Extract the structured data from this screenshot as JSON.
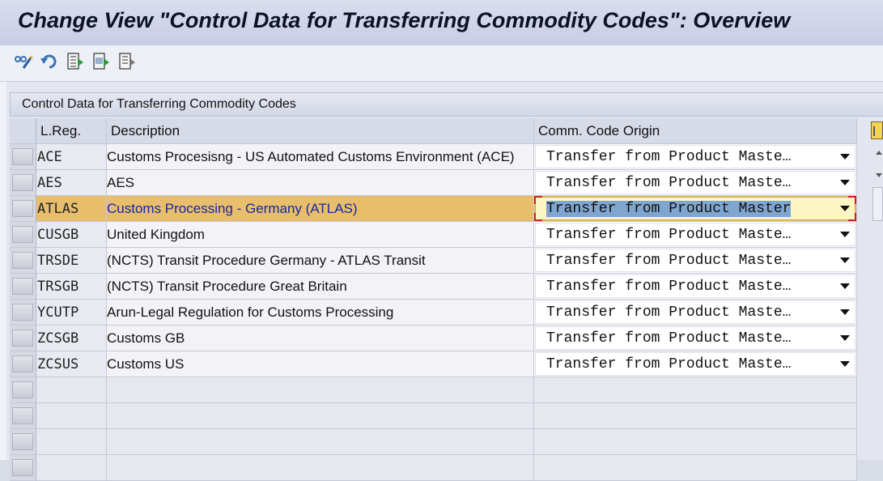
{
  "window": {
    "title": "Change View \"Control Data for Transferring Commodity Codes\": Overview"
  },
  "toolbar": {
    "items": [
      {
        "name": "display-change-icon"
      },
      {
        "name": "undo-icon"
      },
      {
        "name": "select-all-icon"
      },
      {
        "name": "select-block-icon"
      },
      {
        "name": "deselect-all-icon"
      }
    ]
  },
  "table": {
    "title": "Control Data for Transferring Commodity Codes",
    "columns": {
      "lreg": "L.Reg.",
      "description": "Description",
      "origin": "Comm. Code Origin"
    },
    "rows": [
      {
        "lreg": "ACE",
        "description": "Customs Procesisng - US Automated Customs Environment (ACE)",
        "origin": "Transfer from Product Maste…"
      },
      {
        "lreg": "AES",
        "description": "AES",
        "origin": "Transfer from Product Maste…"
      },
      {
        "lreg": "ATLAS",
        "description": "Customs Processing - Germany (ATLAS)",
        "origin": "Transfer from Product Master",
        "selected": true
      },
      {
        "lreg": "CUSGB",
        "description": " United Kingdom",
        "origin": "Transfer from Product Maste…"
      },
      {
        "lreg": "TRSDE",
        "description": "(NCTS) Transit Procedure Germany - ATLAS Transit",
        "origin": "Transfer from Product Maste…"
      },
      {
        "lreg": "TRSGB",
        "description": "(NCTS) Transit Procedure Great Britain",
        "origin": "Transfer from Product Maste…"
      },
      {
        "lreg": "YCUTP",
        "description": "Arun-Legal Regulation for Customs Processing",
        "origin": "Transfer from Product Maste…"
      },
      {
        "lreg": "ZCSGB",
        "description": "Customs GB",
        "origin": "Transfer from Product Maste…"
      },
      {
        "lreg": "ZCSUS",
        "description": "Customs US",
        "origin": "Transfer from Product Maste…"
      }
    ]
  },
  "colors": {
    "selected_row": "#e8bd6c",
    "selected_text": "#152a9c",
    "focus_border": "#d0201a"
  }
}
